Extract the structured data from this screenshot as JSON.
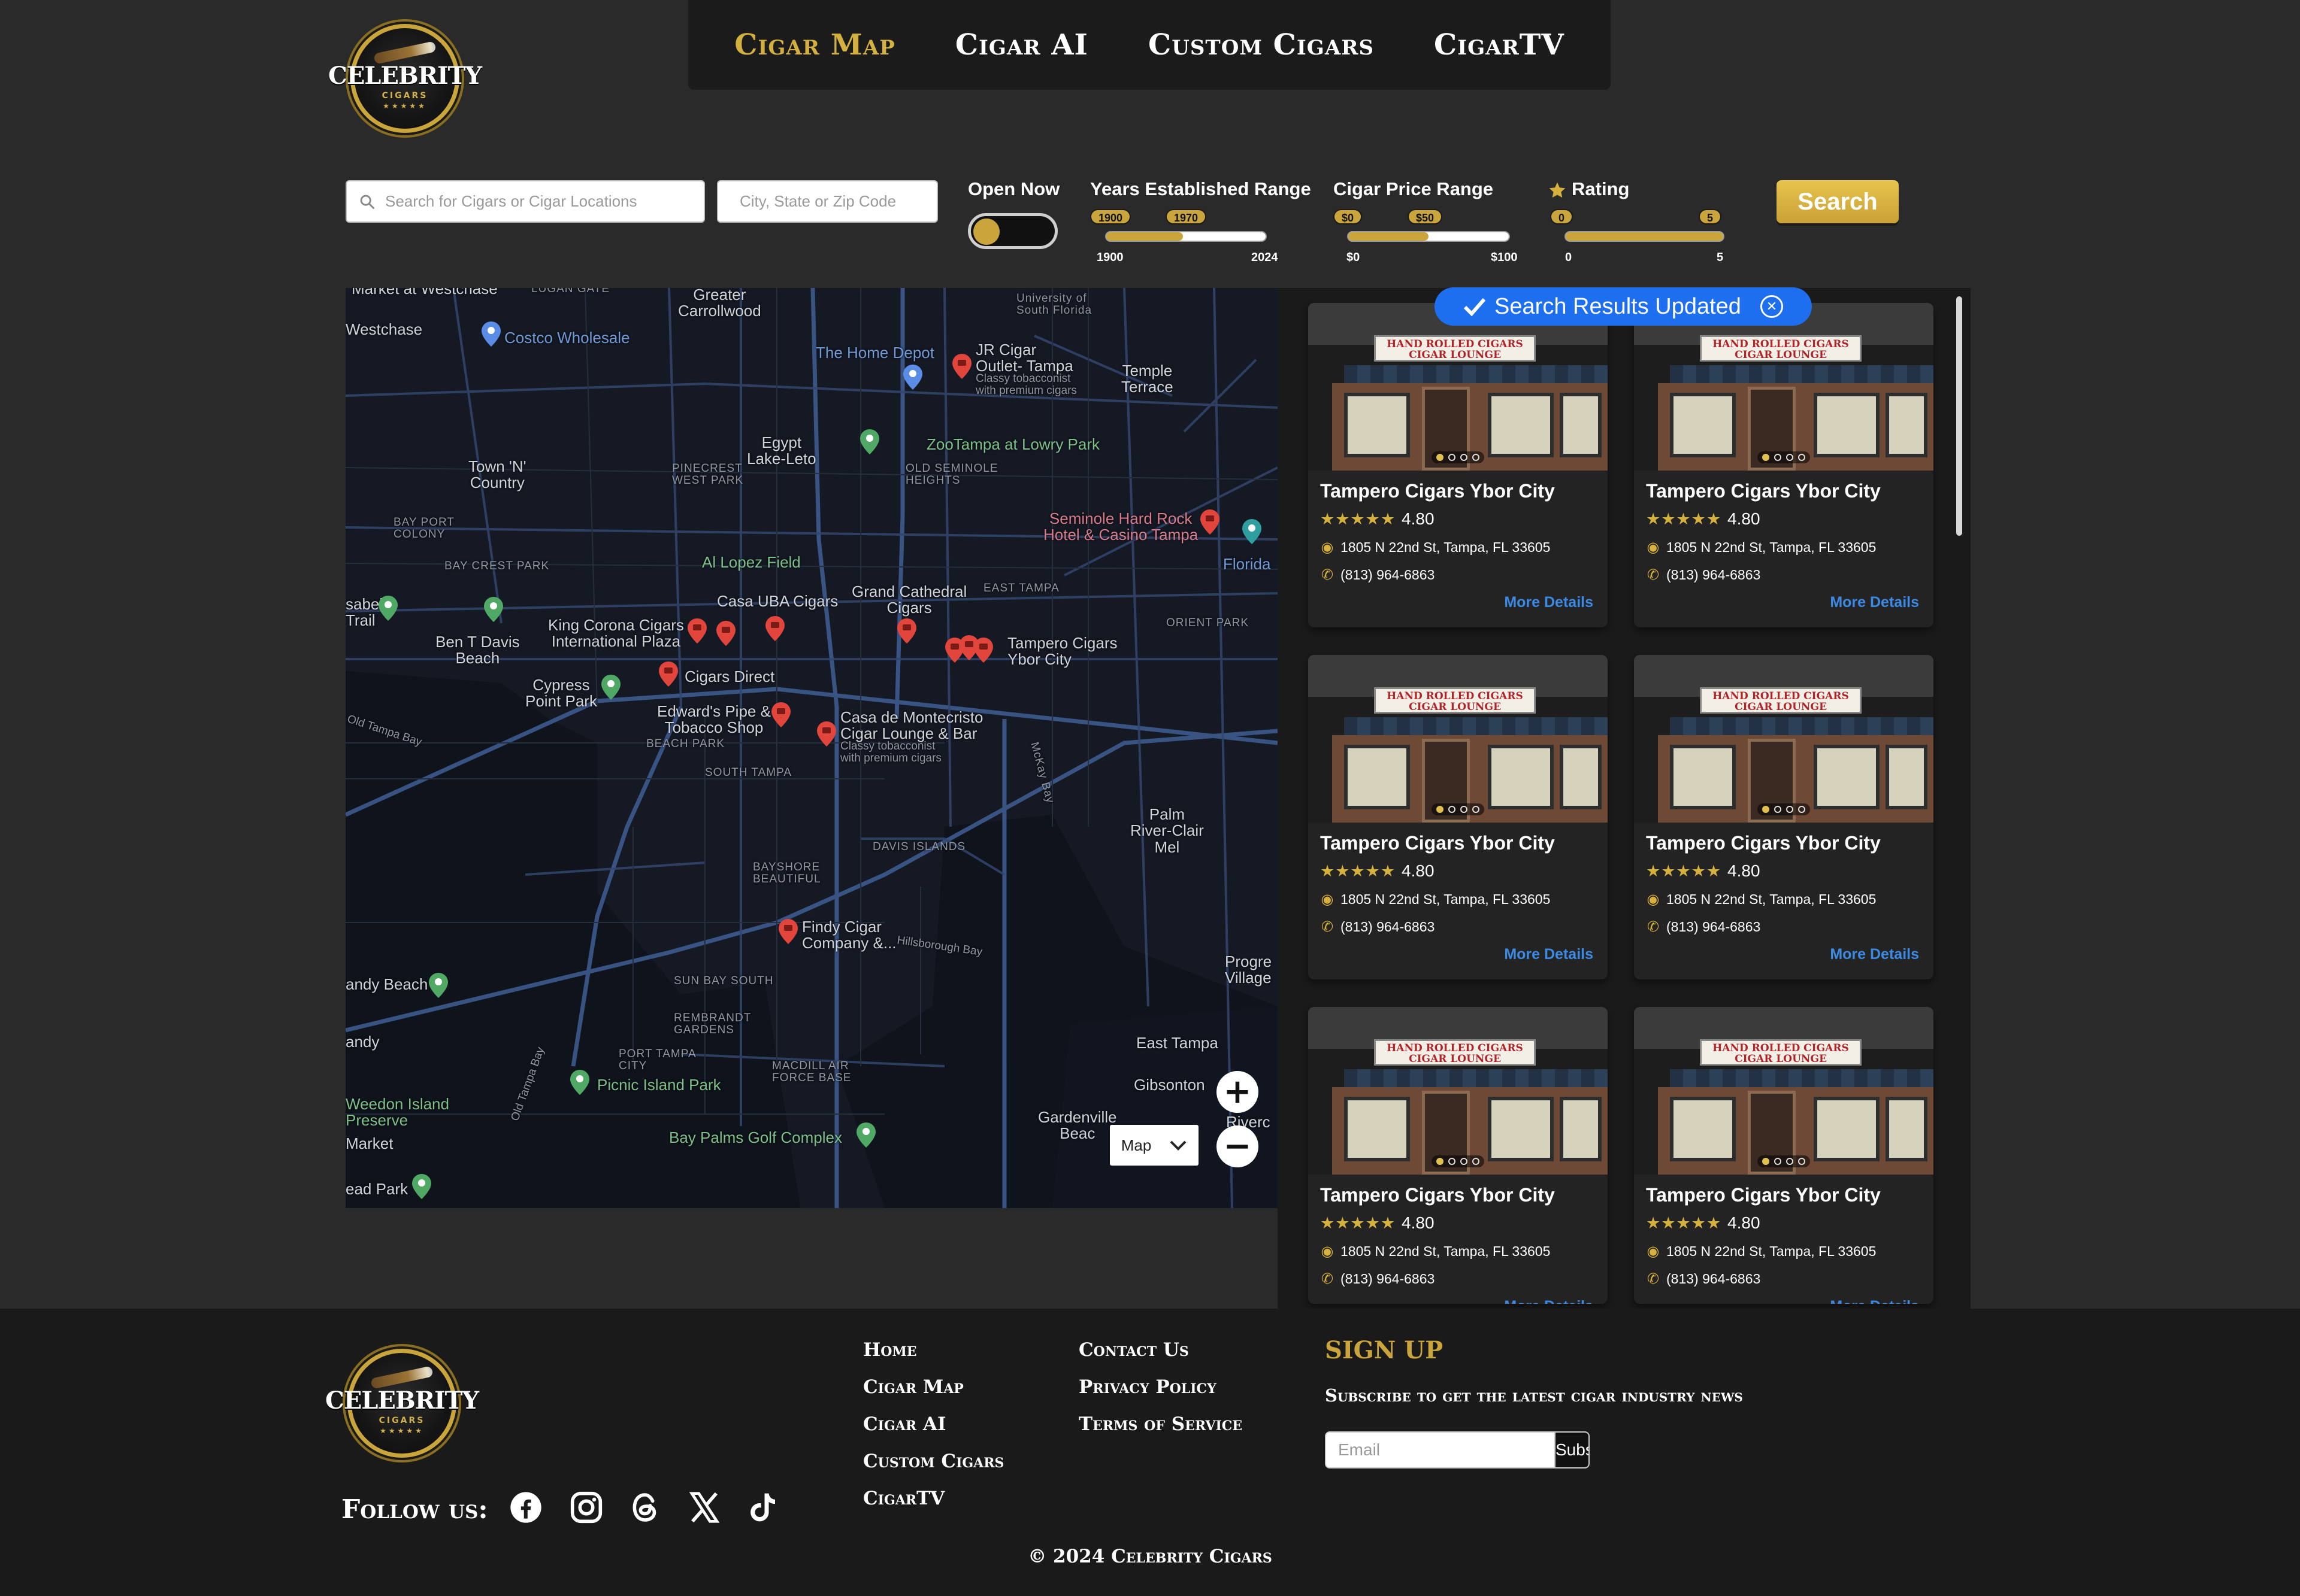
{
  "brand": {
    "name": "CELEBRITY",
    "sub": "CIGARS",
    "stars": "★★★★★"
  },
  "nav": {
    "items": [
      {
        "label": "Cigar Map",
        "active": true
      },
      {
        "label": "Cigar AI",
        "active": false
      },
      {
        "label": "Custom Cigars",
        "active": false
      },
      {
        "label": "CigarTV",
        "active": false
      }
    ]
  },
  "filters": {
    "search_placeholder": "Search for Cigars or Cigar Locations",
    "location_placeholder": "City, State or Zip Code",
    "open_now": {
      "label": "Open Now",
      "on": false
    },
    "years": {
      "label": "Years Established Range",
      "from": "1900",
      "to": "1970",
      "min": "1900",
      "max": "2024"
    },
    "price": {
      "label": "Cigar Price Range",
      "from": "$0",
      "to": "$50",
      "min": "$0",
      "max": "$100"
    },
    "rating": {
      "label": "Rating",
      "from": "0",
      "to": "5",
      "min": "0",
      "max": "5"
    },
    "search_button": "Search"
  },
  "map": {
    "type_label": "Map",
    "zoom_in": "+",
    "zoom_out": "−",
    "labels": {
      "greater_carrollwood": "Greater\nCarrollwood",
      "univ_sf": "University of\nSouth Florida",
      "westchase": "Westchase",
      "costco": "Costco Wholesale",
      "home_depot": "The Home Depot",
      "jr_cigar": "JR Cigar\nOutlet- Tampa",
      "jr_cigar_desc": "Classy tobacconist\nwith premium cigars",
      "temple_terrace": "Temple\nTerrace",
      "egypt_lake": "Egypt\nLake-Leto",
      "zoo": "ZooTampa at Lowry Park",
      "town_n_country": "Town 'N'\nCountry",
      "pinecrest": "PINECREST\nWEST PARK",
      "old_seminole": "OLD SEMINOLE\nHEIGHTS",
      "seminole_hard_rock": "Seminole Hard Rock\nHotel & Casino Tampa",
      "bay_port": "BAY PORT\nCOLONY",
      "bay_crest": "BAY CREST PARK",
      "al_lopez": "Al Lopez Field",
      "florida": "Florida",
      "casa_uba": "Casa UBA Cigars",
      "grand_cathedral": "Grand Cathedral\nCigars",
      "east_tampa": "EAST TAMPA",
      "orient_park": "ORIENT PARK",
      "isabell": "sabell\nTrail",
      "ben_davis": "Ben T Davis\nBeach",
      "king_corona": "King Corona Cigars\nInternational Plaza",
      "tampero": "Tampero Cigars\nYbor City",
      "cigars_direct": "Cigars Direct",
      "cypress_point": "Cypress\nPoint Park",
      "old_tampa_bay": "Old Tampa Bay",
      "edwards_pipe": "Edward's Pipe &\nTobacco Shop",
      "casa_montecristo": "Casa de Montecristo\nCigar Lounge & Bar",
      "casa_montecristo_desc": "Classy tobacconist\nwith premium cigars",
      "beach_park": "BEACH PARK",
      "south_tampa": "SOUTH TAMPA",
      "mckay_bay": "McKay Bay",
      "palm_river": "Palm\nRiver-Clair\nMel",
      "davis_islands": "DAVIS ISLANDS",
      "bayshore": "BAYSHORE\nBEAUTIFUL",
      "findy_cigar": "Findy Cigar\nCompany &...",
      "hillsborough_bay": "Hillsborough Bay",
      "sandy_beach": "andy Beach",
      "progress_village": "Progre\nVillage",
      "sun_bay_south": "SUN BAY SOUTH",
      "rembrandt": "REMBRANDT\nGARDENS",
      "sandy": "andy",
      "port_tampa": "PORT TAMPA\nCITY",
      "macdill": "MACDILL AIR\nFORCE BASE",
      "old_tampa_bay_2": "Old Tampa Bay",
      "east_tampa_2": "East Tampa",
      "picnic_island": "Picnic Island Park",
      "gibsonton": "Gibsonton",
      "weedon": "Weedon Island\nPreserve",
      "market": "Market",
      "gardenville": "Gardenville\nBeac",
      "riverc": "Riverc",
      "bay_palms": "Bay Palms Golf Complex",
      "lead_park": "ead Park",
      "market_westchase": "Market at Westchase",
      "luggs": "LUGAN GATE"
    }
  },
  "results": {
    "toast": "Search Results Updated",
    "cards": [
      {
        "sign": "HAND ROLLED CIGARS\nCIGAR LOUNGE",
        "name": "Tampero Cigars Ybor City",
        "stars": "★★★★★",
        "rating": "4.80",
        "address": "1805 N 22nd St, Tampa, FL 33605",
        "phone": "(813) 964-6863",
        "more": "More Details"
      },
      {
        "sign": "HAND ROLLED CIGARS\nCIGAR LOUNGE",
        "name": "Tampero Cigars Ybor City",
        "stars": "★★★★★",
        "rating": "4.80",
        "address": "1805 N 22nd St, Tampa, FL 33605",
        "phone": "(813) 964-6863",
        "more": "More Details"
      },
      {
        "sign": "HAND ROLLED CIGARS\nCIGAR LOUNGE",
        "name": "Tampero Cigars Ybor City",
        "stars": "★★★★★",
        "rating": "4.80",
        "address": "1805 N 22nd St, Tampa, FL 33605",
        "phone": "(813) 964-6863",
        "more": "More Details"
      },
      {
        "sign": "HAND ROLLED CIGARS\nCIGAR LOUNGE",
        "name": "Tampero Cigars Ybor City",
        "stars": "★★★★★",
        "rating": "4.80",
        "address": "1805 N 22nd St, Tampa, FL 33605",
        "phone": "(813) 964-6863",
        "more": "More Details"
      },
      {
        "sign": "HAND ROLLED CIGARS\nCIGAR LOUNGE",
        "name": "Tampero Cigars Ybor City",
        "stars": "★★★★★",
        "rating": "4.80",
        "address": "1805 N 22nd St, Tampa, FL 33605",
        "phone": "(813) 964-6863",
        "more": "More Details"
      },
      {
        "sign": "HAND ROLLED CIGARS\nCIGAR LOUNGE",
        "name": "Tampero Cigars Ybor City",
        "stars": "★★★★★",
        "rating": "4.80",
        "address": "1805 N 22nd St, Tampa, FL 33605",
        "phone": "(813) 964-6863",
        "more": "More Details"
      }
    ]
  },
  "footer": {
    "links_col1": [
      "Home",
      "Cigar Map",
      "Cigar AI",
      "Custom Cigars",
      "CigarTV"
    ],
    "links_col2": [
      "Contact Us",
      "Privacy Policy",
      "Terms of Service"
    ],
    "follow_label": "Follow us:",
    "social": [
      "facebook-icon",
      "instagram-icon",
      "threads-icon",
      "x-icon",
      "tiktok-icon"
    ],
    "signup_title": "SIGN UP",
    "signup_sub": "Subscribe to get the latest cigar industry news",
    "email_placeholder": "Email",
    "subscribe": "Subscribe",
    "copyright": "© 2024 Celebrity Cigars"
  },
  "colors": {
    "gold": "#c9a53b",
    "background": "#2a2a2a",
    "panel": "#1a1a1a",
    "link_blue": "#3b8ae6",
    "toast_blue": "#1e6ff0",
    "pin_red": "#e2453c"
  }
}
